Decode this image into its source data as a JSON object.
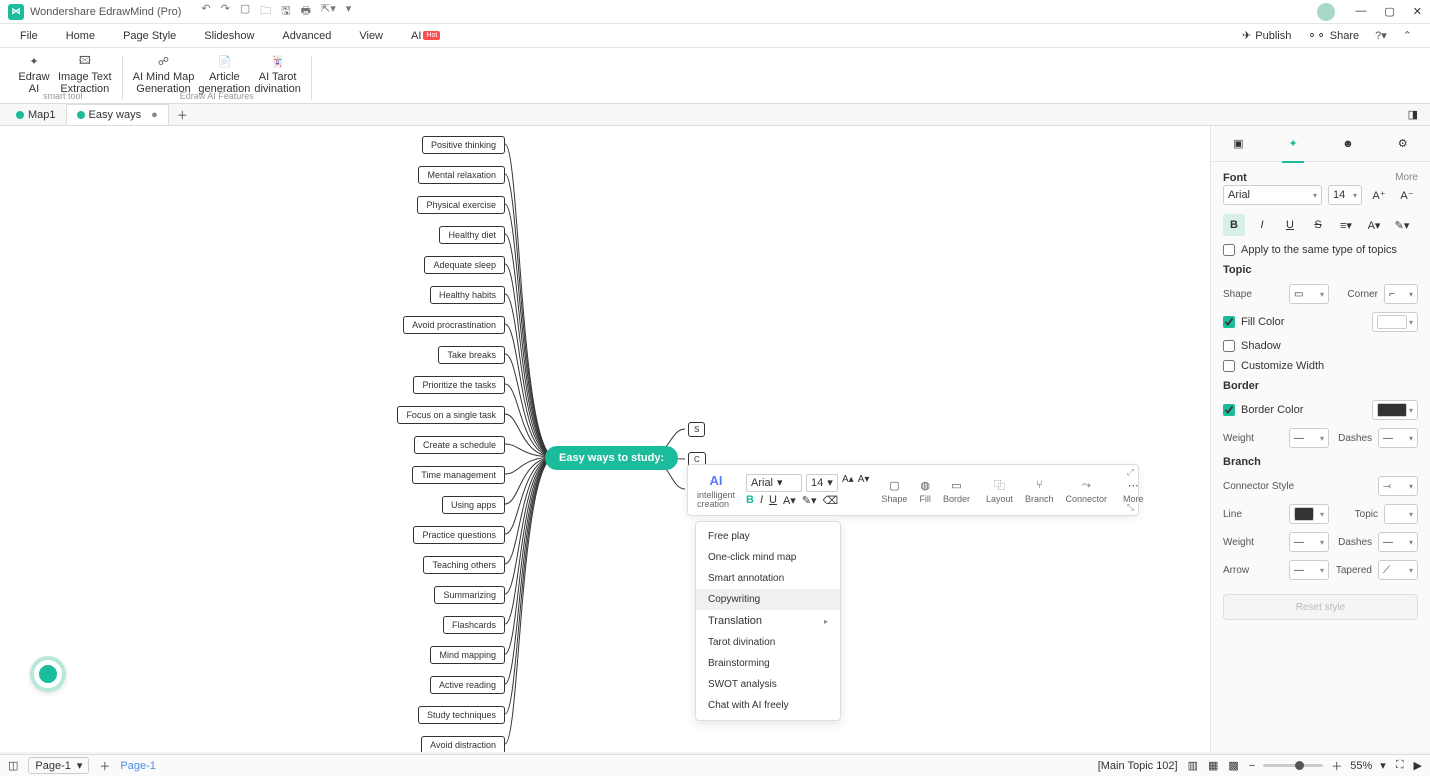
{
  "app": {
    "title": "Wondershare EdrawMind (Pro)"
  },
  "menu": {
    "items": [
      "File",
      "Home",
      "Page Style",
      "Slideshow",
      "Advanced",
      "View"
    ],
    "ai": "AI",
    "hot": "Hot",
    "right": {
      "publish": "Publish",
      "share": "Share"
    }
  },
  "ribbon": {
    "btns": [
      {
        "l1": "Edraw",
        "l2": "AI"
      },
      {
        "l1": "Image Text",
        "l2": "Extraction"
      },
      {
        "l1": "AI Mind Map",
        "l2": "Generation"
      },
      {
        "l1": "Article",
        "l2": "generation"
      },
      {
        "l1": "AI Tarot",
        "l2": "divination"
      }
    ],
    "group1": "smart tool",
    "group2": "Edraw AI Features"
  },
  "tabs": {
    "t1": "Map1",
    "t2": "Easy ways"
  },
  "mindmap": {
    "root": "Easy ways to study:",
    "left": [
      "Positive thinking",
      "Mental relaxation",
      "Physical exercise",
      "Healthy diet",
      "Adequate sleep",
      "Healthy habits",
      "Avoid procrastination",
      "Take breaks",
      "Prioritize the tasks",
      "Focus on a single task",
      "Create a schedule",
      "Time management",
      "Using apps",
      "Practice questions",
      "Teaching others",
      "Summarizing",
      "Flashcards",
      "Mind mapping",
      "Active reading",
      "Study techniques",
      "Avoid distraction"
    ]
  },
  "floatbar": {
    "ai": "intelligent\ncreation",
    "font": "Arial",
    "size": "14",
    "shape": "Shape",
    "fill": "Fill",
    "border": "Border",
    "layout": "Layout",
    "branch": "Branch",
    "connector": "Connector",
    "more": "More"
  },
  "aimenu": [
    "Free play",
    "One-click mind map",
    "Smart annotation",
    "Copywriting",
    "Translation",
    "Tarot divination",
    "Brainstorming",
    "SWOT analysis",
    "Chat with AI freely"
  ],
  "panel": {
    "more": "More",
    "font": {
      "title": "Font",
      "family": "Arial",
      "size": "14",
      "apply": "Apply to the same type of topics"
    },
    "topic": {
      "title": "Topic",
      "shape": "Shape",
      "corner": "Corner",
      "fill": "Fill Color",
      "shadow": "Shadow",
      "custw": "Customize Width"
    },
    "border": {
      "title": "Border",
      "color": "Border Color",
      "weight": "Weight",
      "dashes": "Dashes"
    },
    "branch": {
      "title": "Branch",
      "conn": "Connector Style",
      "line": "Line",
      "topic": "Topic",
      "weight": "Weight",
      "dashes": "Dashes",
      "arrow": "Arrow",
      "tapered": "Tapered"
    },
    "reset": "Reset style"
  },
  "status": {
    "page": "Page-1",
    "pagelabel": "Page-1",
    "maintopic": "[Main Topic 102]",
    "zoom": "55%"
  }
}
